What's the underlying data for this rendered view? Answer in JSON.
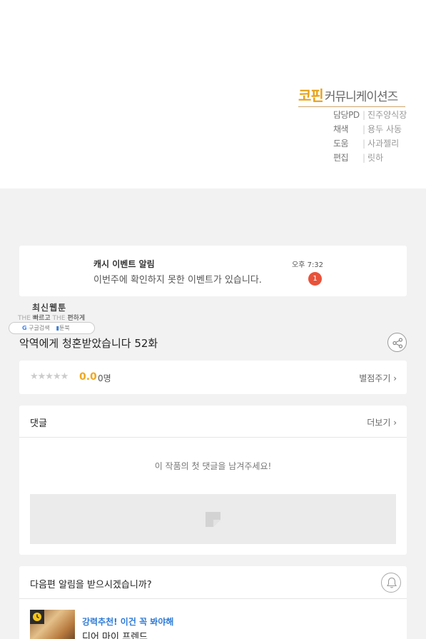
{
  "credits": {
    "brand_accent": "코핀",
    "brand_rest": "커뮤니케이션즈",
    "rows": [
      {
        "role": "담당PD",
        "name": "진주양식장"
      },
      {
        "role": "채색",
        "name": "용두 사동"
      },
      {
        "role": "도움",
        "name": "사과젤리"
      },
      {
        "role": "편집",
        "name": "릿하"
      }
    ]
  },
  "event": {
    "title": "캐시 이벤트 알림",
    "description": "이번주에 확인하지 못한 이벤트가 있습니다.",
    "time": "오후 7:32",
    "badge": "1"
  },
  "watermark": {
    "title": "최신웹툰",
    "sub_the1": "THE",
    "sub_fast": "빠르고",
    "sub_the2": "THE",
    "sub_easy": "편하게",
    "pill_google": "G",
    "pill_search": "구글검색",
    "pill_book": "툰북"
  },
  "episode": {
    "title": "악역에게 청혼받았습니다 52화"
  },
  "rating": {
    "stars": "★★★★★",
    "stars_filled": 0,
    "score": "0.0",
    "count": "0명",
    "rate_link": "별점주기 ›"
  },
  "comments": {
    "title": "댓글",
    "more": "더보기 ›",
    "empty_text": "이 작품의 첫 댓글을 남겨주세요!"
  },
  "notify": {
    "title": "다음편 알림을 받으시겠습니까?",
    "recommend_label": "강력추천! 이건 꼭 봐야해",
    "recommend_title": "디어 마이 프렌드"
  },
  "colors": {
    "accent_gold": "#e6a21a",
    "badge_red": "#e8523a",
    "link_blue": "#2e7bd6"
  }
}
